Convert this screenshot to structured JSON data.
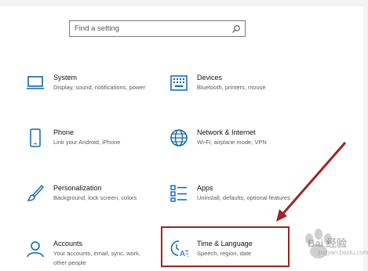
{
  "search": {
    "placeholder": "Find a setting",
    "icon": "search-icon"
  },
  "tiles": [
    {
      "title": "System",
      "desc": "Display, sound, notifications, power",
      "icon": "laptop-icon"
    },
    {
      "title": "Devices",
      "desc": "Bluetooth, printers, mouse",
      "icon": "keyboard-icon"
    },
    {
      "title": "Phone",
      "desc": "Link your Android, iPhone",
      "icon": "phone-icon"
    },
    {
      "title": "Network & Internet",
      "desc": "Wi-Fi, airplane mode, VPN",
      "icon": "globe-icon"
    },
    {
      "title": "Personalization",
      "desc": "Background, lock screen, colors",
      "icon": "brush-icon"
    },
    {
      "title": "Apps",
      "desc": "Uninstall, defaults, optional features",
      "icon": "apps-list-icon"
    },
    {
      "title": "Accounts",
      "desc": "Your accounts, email, sync, work, other people",
      "icon": "person-icon"
    },
    {
      "title": "Time & Language",
      "desc": "Speech, region, date",
      "icon": "time-language-icon"
    }
  ],
  "annotation": {
    "color": "#a12323"
  },
  "watermark": {
    "text": "Bai 经验",
    "sub": "jingyan.baidu.com"
  },
  "colors": {
    "accent": "#0a67b0"
  }
}
